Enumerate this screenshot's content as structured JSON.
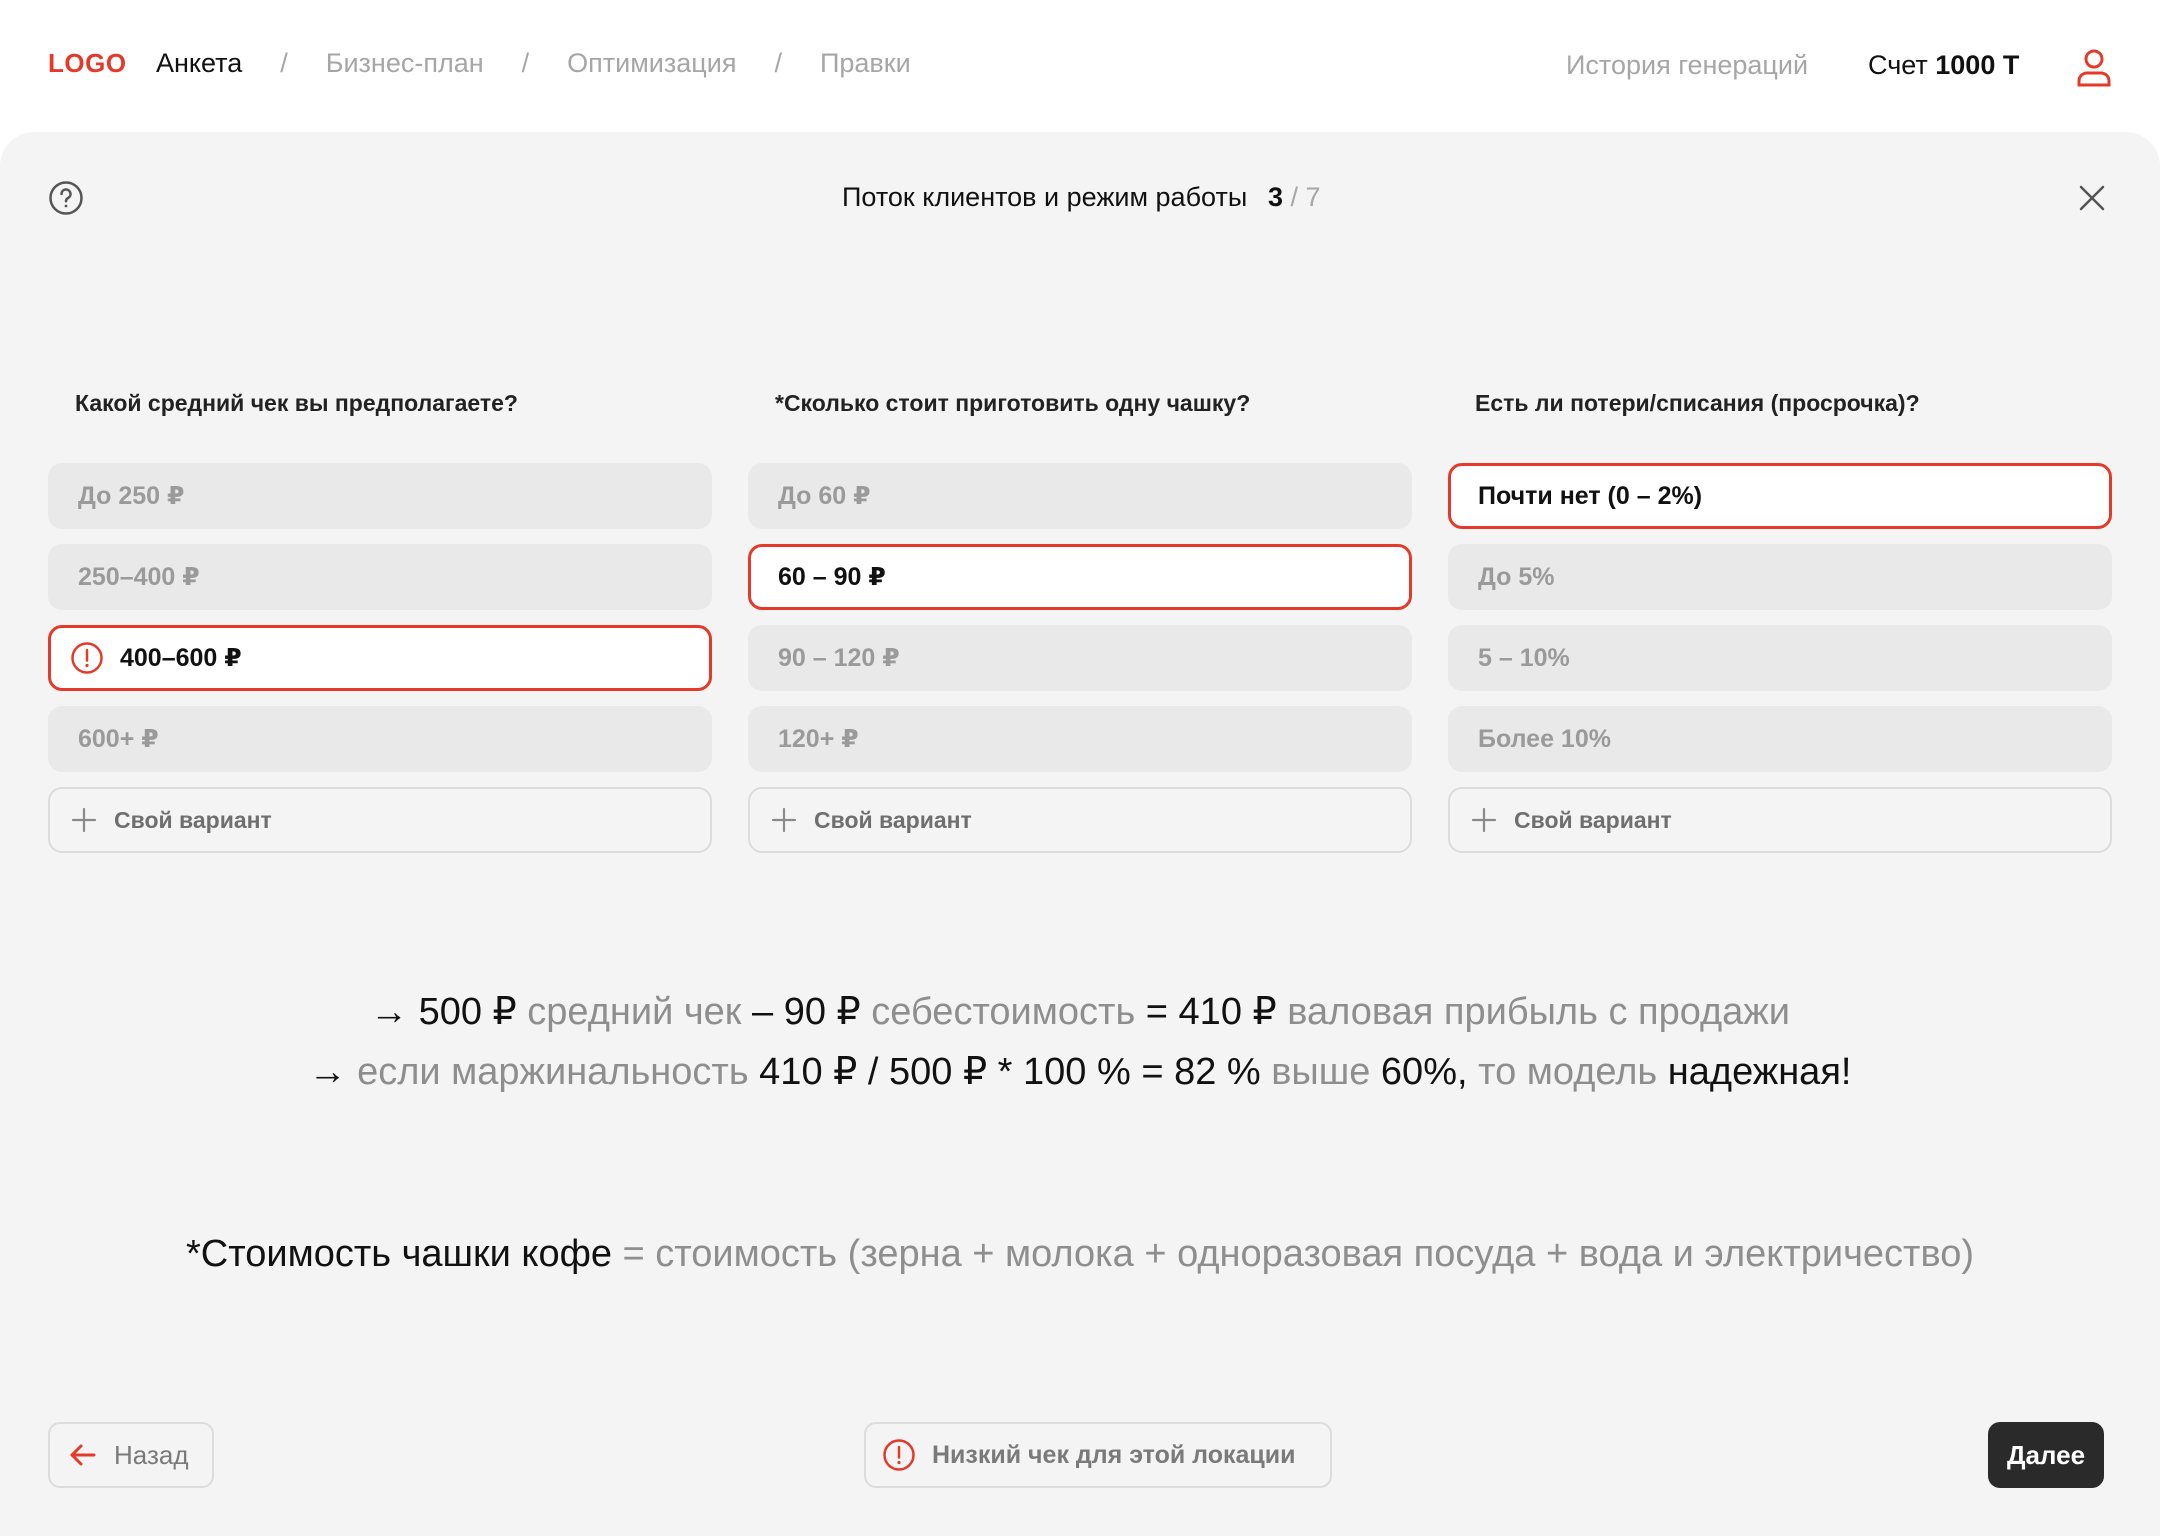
{
  "nav": {
    "logo": "LOGO",
    "crumbs": [
      {
        "label": "Анкета",
        "active": true
      },
      {
        "label": "Бизнес-план",
        "active": false
      },
      {
        "label": "Оптимизация",
        "active": false
      },
      {
        "label": "Правки",
        "active": false
      }
    ],
    "separator": "/",
    "history_label": "История генераций",
    "account_label": "Счет",
    "account_value": "1000 T"
  },
  "step": {
    "title": "Поток клиентов и режим работы",
    "current": "3",
    "total": "/ 7"
  },
  "questions": [
    {
      "label": "Какой средний чек вы предполагаете?",
      "options": [
        {
          "label": "До 250 ₽",
          "selected": false
        },
        {
          "label": "250–400 ₽",
          "selected": false
        },
        {
          "label": "400–600 ₽",
          "selected": true,
          "warning": true
        },
        {
          "label": "600+ ₽",
          "selected": false
        }
      ],
      "custom_label": "Свой вариант"
    },
    {
      "label": "*Сколько стоит приготовить одну чашку?",
      "options": [
        {
          "label": "До 60 ₽",
          "selected": false
        },
        {
          "label": "60 – 90 ₽",
          "selected": true
        },
        {
          "label": "90 – 120 ₽",
          "selected": false
        },
        {
          "label": "120+ ₽",
          "selected": false
        }
      ],
      "custom_label": "Свой вариант"
    },
    {
      "label": "Есть ли потери/списания (просрочка)?",
      "options": [
        {
          "label": "Почти нет (0 – 2%)",
          "selected": true
        },
        {
          "label": "До 5%",
          "selected": false
        },
        {
          "label": "5 – 10%",
          "selected": false
        },
        {
          "label": "Более 10%",
          "selected": false
        }
      ],
      "custom_label": "Свой вариант"
    }
  ],
  "formula": {
    "line1": [
      {
        "t": "→ 500 ₽",
        "s": "k"
      },
      {
        "t": " средний чек ",
        "s": "g"
      },
      {
        "t": "– 90 ₽",
        "s": "k"
      },
      {
        "t": " себестоимость ",
        "s": "g"
      },
      {
        "t": "= 410 ₽",
        "s": "k"
      },
      {
        "t": " валовая прибыль с продажи",
        "s": "g"
      }
    ],
    "line2": [
      {
        "t": "→",
        "s": "k"
      },
      {
        "t": " если маржинальность ",
        "s": "g"
      },
      {
        "t": "410 ₽ / 500 ₽ * 100 % = 82 %",
        "s": "k"
      },
      {
        "t": " выше ",
        "s": "g"
      },
      {
        "t": "60%,",
        "s": "k"
      },
      {
        "t": " то модель ",
        "s": "g"
      },
      {
        "t": "надежная!",
        "s": "k"
      }
    ],
    "note": [
      {
        "t": "*Стоимость чашки кофе",
        "s": "k"
      },
      {
        "t": " = стоимость (зерна + молока + одноразовая посуда + вода и электричество)",
        "s": "g"
      }
    ]
  },
  "footer": {
    "back_label": "Назад",
    "warning_label": "Низкий чек для этой локации",
    "next_label": "Далее"
  },
  "colors": {
    "accent": "#e53a2a",
    "card_bg": "#f4f4f4",
    "option_bg": "#e9e9e9",
    "next_bg": "#2a2a2a"
  },
  "icons": [
    "user-icon",
    "help-icon",
    "close-icon",
    "warning-icon",
    "plus-icon",
    "arrow-left-icon"
  ]
}
